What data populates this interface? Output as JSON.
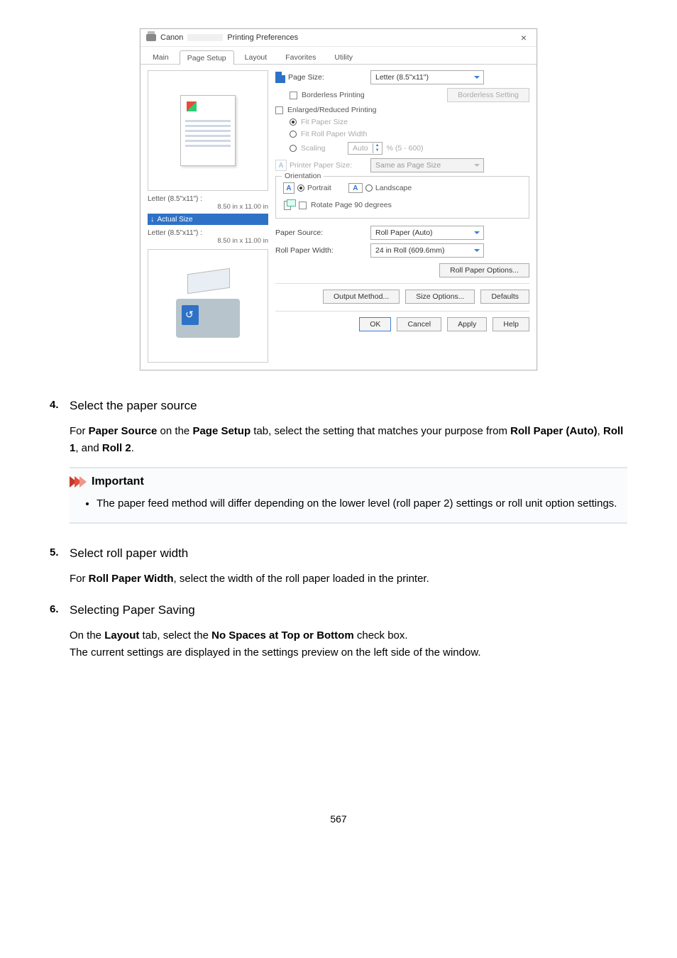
{
  "dialog": {
    "vendor": "Canon",
    "title_suffix": "Printing Preferences",
    "close": "×",
    "tabs": [
      "Main",
      "Page Setup",
      "Layout",
      "Favorites",
      "Utility"
    ],
    "active_tab": 1,
    "preview": {
      "caption1": "Letter (8.5\"x11\") :",
      "caption1_dim": "8.50 in x 11.00 in",
      "actual_size": "Actual Size",
      "caption2": "Letter (8.5\"x11\") :",
      "caption2_dim": "8.50 in x 11.00 in"
    },
    "settings": {
      "page_size_label": "Page Size:",
      "page_size_value": "Letter (8.5\"x11\")",
      "borderless_printing": "Borderless Printing",
      "borderless_setting_btn": "Borderless Setting",
      "enlarged_reduced": "Enlarged/Reduced Printing",
      "fit_paper": "Fit Paper Size",
      "fit_roll": "Fit Roll Paper Width",
      "scaling_label": "Scaling",
      "scaling_value": "Auto",
      "scaling_range": "% (5 - 600)",
      "printer_paper_size_label": "Printer Paper Size:",
      "printer_paper_size_value": "Same as Page Size",
      "orientation_title": "Orientation",
      "portrait": "Portrait",
      "landscape": "Landscape",
      "rotate90": "Rotate Page 90 degrees",
      "paper_source_label": "Paper Source:",
      "paper_source_value": "Roll Paper (Auto)",
      "roll_width_label": "Roll Paper Width:",
      "roll_width_value": "24 in Roll (609.6mm)",
      "roll_options_btn": "Roll Paper Options...",
      "output_method_btn": "Output Method...",
      "size_options_btn": "Size Options...",
      "defaults_btn": "Defaults"
    },
    "footer": {
      "ok": "OK",
      "cancel": "Cancel",
      "apply": "Apply",
      "help": "Help"
    }
  },
  "steps": {
    "s4_num": "4.",
    "s4_title": "Select the paper source",
    "s4_text_a": "For ",
    "s4_text_b": " on the ",
    "s4_text_c": " tab, select the setting that matches your purpose from ",
    "s4_text_d": ", ",
    "s4_text_e": ", and ",
    "s4_text_f": ".",
    "s4_bold1": "Paper Source",
    "s4_bold2": "Page Setup",
    "s4_bold3": "Roll Paper (Auto)",
    "s4_bold4": "Roll 1",
    "s4_bold5": "Roll 2",
    "important_title": "Important",
    "important_bullet": "The paper feed method will differ depending on the lower level (roll paper 2) settings or roll unit option settings.",
    "s5_num": "5.",
    "s5_title": "Select roll paper width",
    "s5_text_a": "For ",
    "s5_text_b": ", select the width of the roll paper loaded in the printer.",
    "s5_bold1": "Roll Paper Width",
    "s6_num": "6.",
    "s6_title": "Selecting Paper Saving",
    "s6_text_a": "On the ",
    "s6_text_b": " tab, select the ",
    "s6_text_c": " check box.",
    "s6_bold1": "Layout",
    "s6_bold2": "No Spaces at Top or Bottom",
    "s6_text2": "The current settings are displayed in the settings preview on the left side of the window."
  },
  "page_number": "567"
}
